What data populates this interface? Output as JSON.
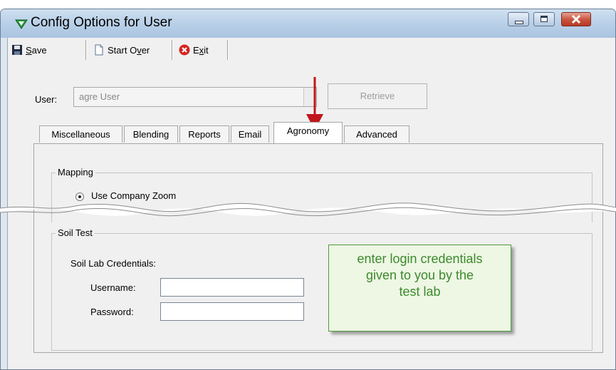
{
  "window": {
    "title": "Config Options for User"
  },
  "toolbar": {
    "save_prefix": "S",
    "save_suffix": "ave",
    "start_over_prefix": "Start O",
    "start_over_key": "v",
    "start_over_suffix": "er",
    "exit_prefix": "E",
    "exit_key": "x",
    "exit_suffix": "it"
  },
  "user": {
    "label": "User:",
    "value": "agre User",
    "retrieve_label": "Retrieve"
  },
  "tabs": [
    {
      "label": "Miscellaneous"
    },
    {
      "label": "Blending"
    },
    {
      "label": "Reports"
    },
    {
      "label": "Email"
    },
    {
      "label": "Agronomy"
    },
    {
      "label": "Advanced"
    }
  ],
  "active_tab": "Agronomy",
  "mapping": {
    "title": "Mapping",
    "option_label": "Use Company Zoom",
    "selected": true
  },
  "soil_test": {
    "title": "Soil Test",
    "credentials_label": "Soil Lab Credentials:",
    "username_label": "Username:",
    "username_value": "",
    "password_label": "Password:",
    "password_value": ""
  },
  "callout": {
    "line1": "enter login credentials",
    "line2": "given to you by the",
    "line3": "test lab"
  },
  "colors": {
    "arrow": "#c0161b",
    "callout_text": "#3b8a2c",
    "callout_border": "#4f9a3e"
  }
}
